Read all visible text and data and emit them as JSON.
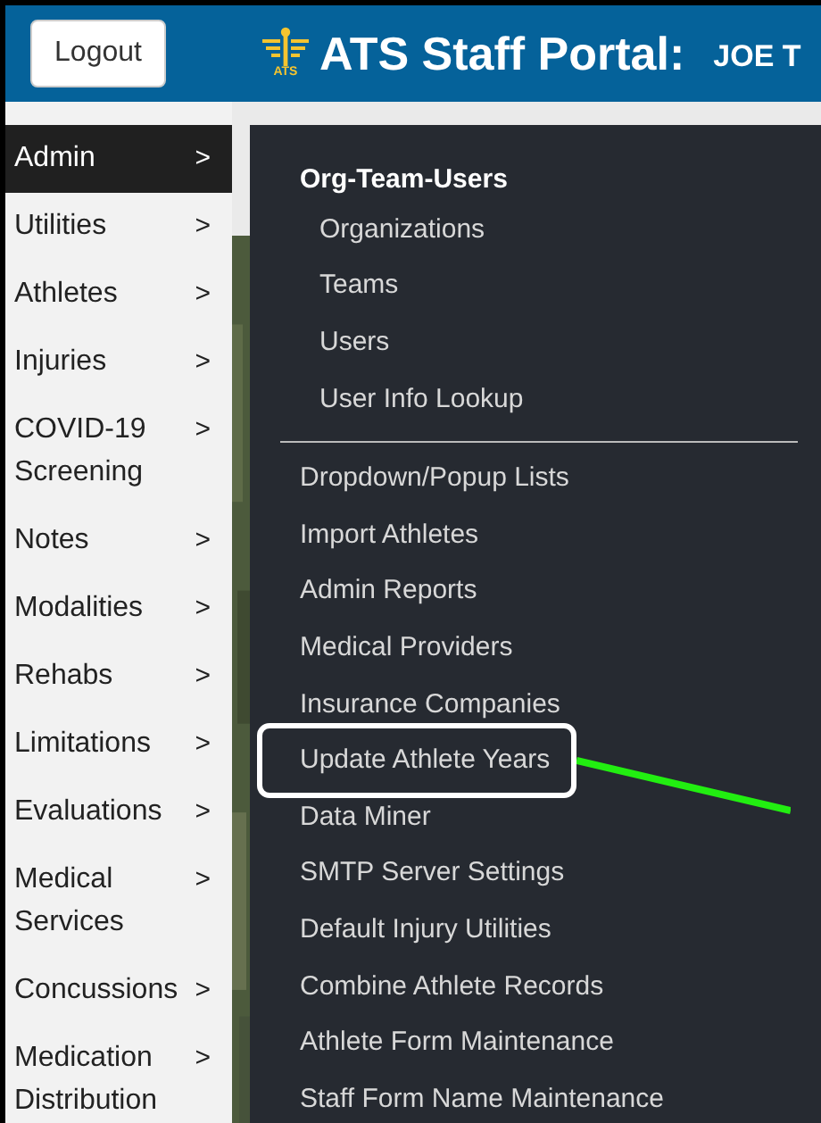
{
  "header": {
    "logout_button": "Logout",
    "logo_text": "ATS",
    "title": "ATS Staff Portal:",
    "user": "JOE T"
  },
  "sidebar": {
    "items": [
      {
        "label": "Admin",
        "arrow": ">",
        "selected": true
      },
      {
        "label": "Utilities",
        "arrow": ">",
        "selected": false
      },
      {
        "label": "Athletes",
        "arrow": ">",
        "selected": false
      },
      {
        "label": "Injuries",
        "arrow": ">",
        "selected": false
      },
      {
        "label": "COVID-19 Screening",
        "arrow": ">",
        "selected": false
      },
      {
        "label": "Notes",
        "arrow": ">",
        "selected": false
      },
      {
        "label": "Modalities",
        "arrow": ">",
        "selected": false
      },
      {
        "label": "Rehabs",
        "arrow": ">",
        "selected": false
      },
      {
        "label": "Limitations",
        "arrow": ">",
        "selected": false
      },
      {
        "label": "Evaluations",
        "arrow": ">",
        "selected": false
      },
      {
        "label": "Medical Services",
        "arrow": ">",
        "selected": false
      },
      {
        "label": "Concussions",
        "arrow": ">",
        "selected": false
      },
      {
        "label": "Medication Distribution",
        "arrow": ">",
        "selected": false
      }
    ]
  },
  "menu": {
    "section_title": "Org-Team-Users",
    "section_items": [
      "Organizations",
      "Teams",
      "Users",
      "User Info Lookup"
    ],
    "items": [
      {
        "label": "Dropdown/Popup Lists",
        "highlighted": false
      },
      {
        "label": "Import Athletes",
        "highlighted": false
      },
      {
        "label": "Admin Reports",
        "highlighted": false
      },
      {
        "label": "Medical Providers",
        "highlighted": false
      },
      {
        "label": "Insurance Companies",
        "highlighted": false
      },
      {
        "label": "Update Athlete Years",
        "highlighted": true
      },
      {
        "label": "Data Miner",
        "highlighted": false
      },
      {
        "label": "SMTP Server Settings",
        "highlighted": false
      },
      {
        "label": "Default Injury Utilities",
        "highlighted": false
      },
      {
        "label": "Combine Athlete Records",
        "highlighted": false
      },
      {
        "label": "Athlete Form Maintenance",
        "highlighted": false
      },
      {
        "label": "Staff Form Name Maintenance",
        "highlighted": false
      }
    ]
  }
}
